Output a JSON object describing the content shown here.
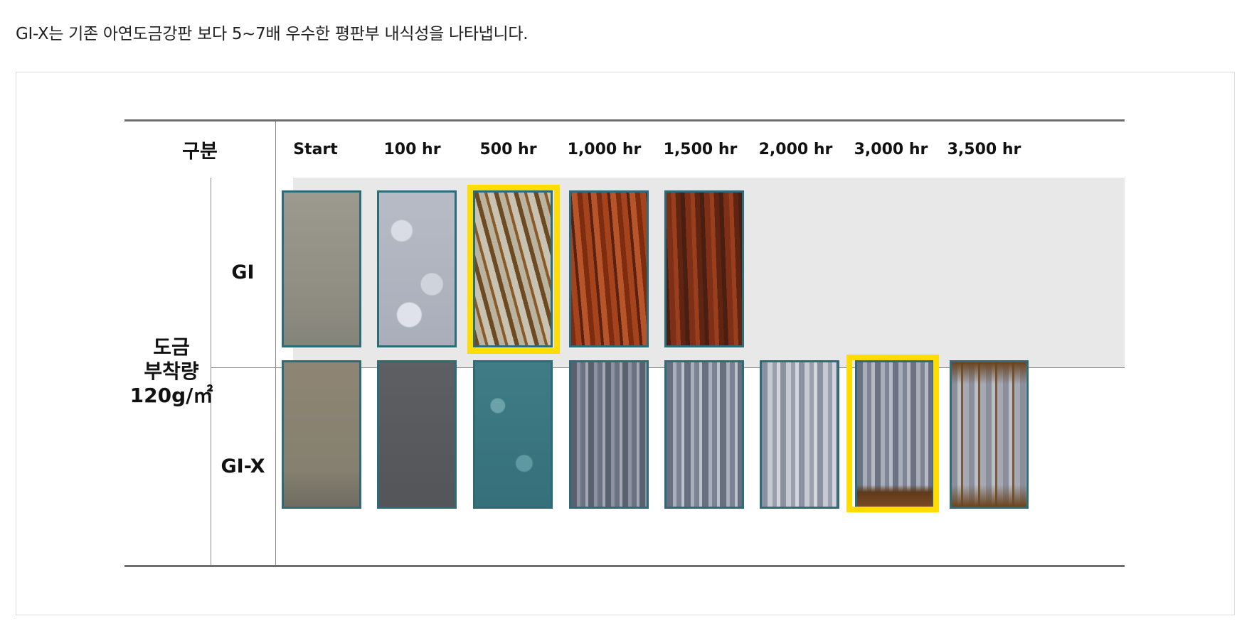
{
  "intro_text": "GI-X는 기존 아연도금강판 보다 5~7배 우수한 평판부 내식성을 나타냅니다.",
  "table": {
    "header_label": "구분",
    "columns": [
      "Start",
      "100 hr",
      "500 hr",
      "1,000 hr",
      "1,500 hr",
      "2,000 hr",
      "3,000 hr",
      "3,500 hr"
    ],
    "group_label_lines": [
      "도금",
      "부착량",
      "120g/㎡"
    ],
    "rows": [
      {
        "label": "GI",
        "panels_shown": 5,
        "highlighted_column": "500 hr"
      },
      {
        "label": "GI-X",
        "panels_shown": 8,
        "highlighted_column": "3,000 hr"
      }
    ]
  },
  "colors": {
    "highlight": "#ffdd00",
    "gi_row_background": "#e8e8e8",
    "rule": "#6d6d6d"
  }
}
